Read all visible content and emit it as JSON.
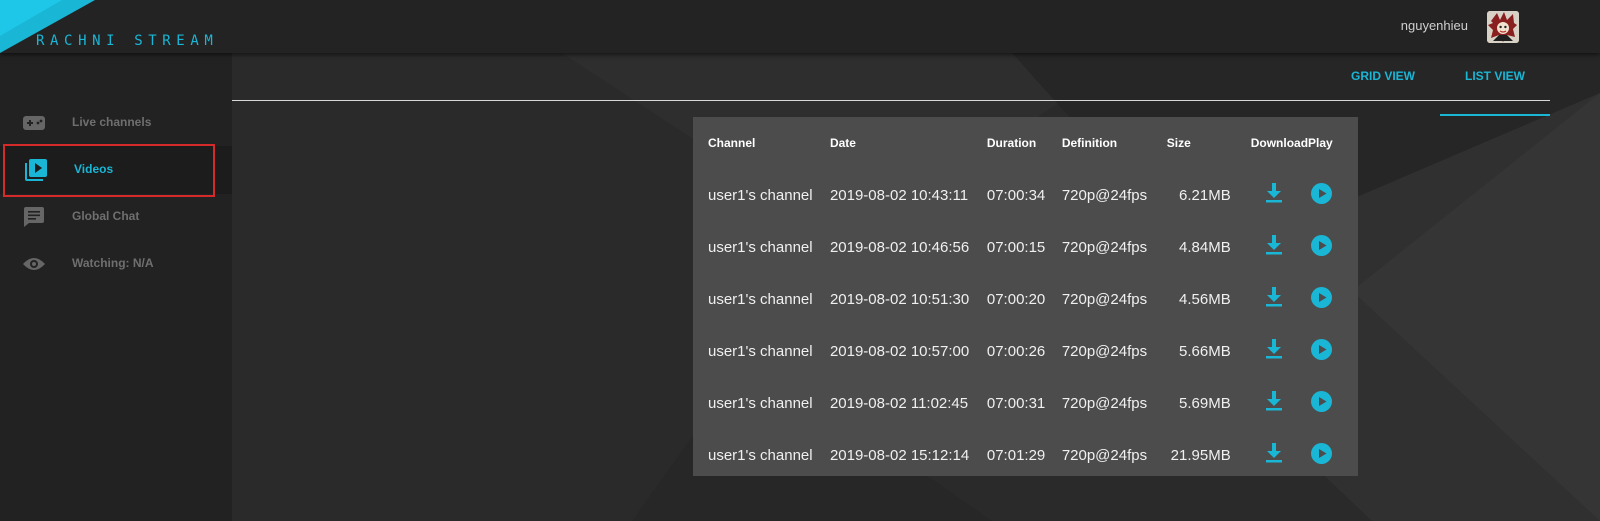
{
  "app": {
    "brand": "RACHNI STREAM",
    "accent_color": "#19b6d6"
  },
  "user": {
    "name": "nguyenhieu"
  },
  "sidebar": {
    "items": [
      {
        "label": "Live channels",
        "icon": "gamepad-icon"
      },
      {
        "label": "Videos",
        "icon": "video-library-icon",
        "active": true
      },
      {
        "label": "Global Chat",
        "icon": "chat-icon"
      },
      {
        "label": "Watching: N/A",
        "icon": "eye-icon"
      }
    ]
  },
  "tabs": {
    "grid": "GRID VIEW",
    "list": "LIST VIEW",
    "active": "list"
  },
  "videos": {
    "columns": [
      "Channel",
      "Date",
      "Duration",
      "Definition",
      "Size",
      "Download",
      "Play"
    ],
    "rows": [
      {
        "channel": "user1's channel",
        "date": "2019-08-02 10:43:11",
        "duration": "07:00:34",
        "definition": "720p@24fps",
        "size": "6.21MB"
      },
      {
        "channel": "user1's channel",
        "date": "2019-08-02 10:46:56",
        "duration": "07:00:15",
        "definition": "720p@24fps",
        "size": "4.84MB"
      },
      {
        "channel": "user1's channel",
        "date": "2019-08-02 10:51:30",
        "duration": "07:00:20",
        "definition": "720p@24fps",
        "size": "4.56MB"
      },
      {
        "channel": "user1's channel",
        "date": "2019-08-02 10:57:00",
        "duration": "07:00:26",
        "definition": "720p@24fps",
        "size": "5.66MB"
      },
      {
        "channel": "user1's channel",
        "date": "2019-08-02 11:02:45",
        "duration": "07:00:31",
        "definition": "720p@24fps",
        "size": "5.69MB"
      },
      {
        "channel": "user1's channel",
        "date": "2019-08-02 15:12:14",
        "duration": "07:01:29",
        "definition": "720p@24fps",
        "size": "21.95MB"
      }
    ]
  }
}
